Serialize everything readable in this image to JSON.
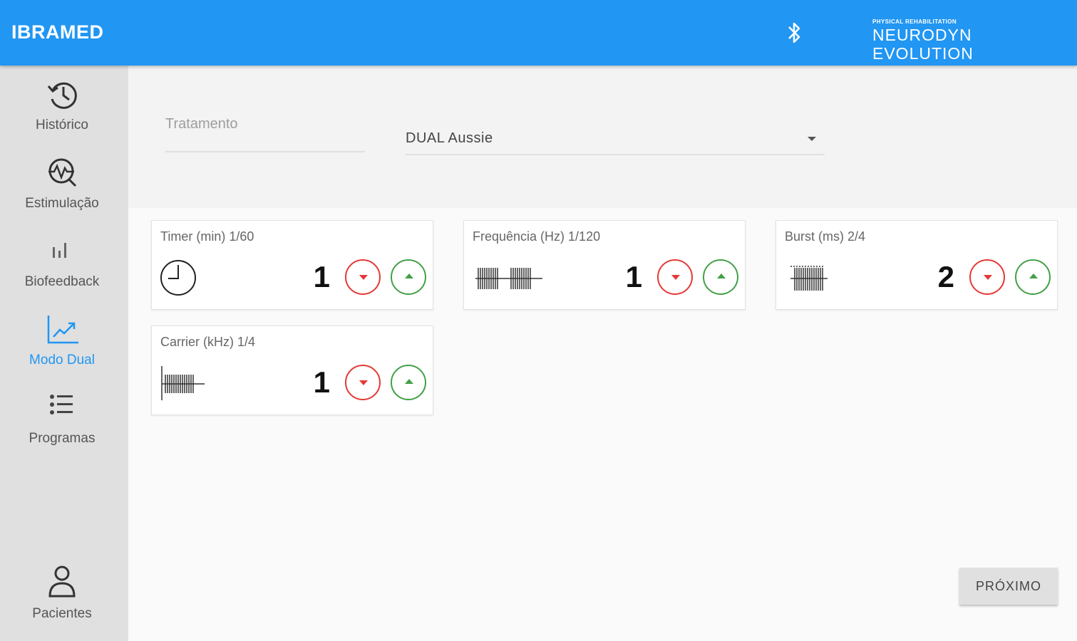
{
  "app": {
    "brand": "IBRAMED",
    "logo_small": "PHYSICAL REHABILITATION",
    "logo_big": "NEURODYN EVOLUTION",
    "accent_color": "#2196f3"
  },
  "sidebar": {
    "items": [
      {
        "label": "Histórico",
        "icon": "history-icon"
      },
      {
        "label": "Estimulação",
        "icon": "stimulation-icon"
      },
      {
        "label": "Biofeedback",
        "icon": "bar-chart-icon"
      },
      {
        "label": "Modo Dual",
        "icon": "trending-up-icon",
        "active": true
      },
      {
        "label": "Programas",
        "icon": "list-icon"
      },
      {
        "label": "Pacientes",
        "icon": "person-icon"
      }
    ]
  },
  "treatment": {
    "label": "Tratamento",
    "selected": "DUAL Aussie"
  },
  "params": [
    {
      "title": "Timer (min) 1/60",
      "value": "1",
      "icon": "clock-icon"
    },
    {
      "title": "Frequência (Hz) 1/120",
      "value": "1",
      "icon": "frequency-wave-icon"
    },
    {
      "title": "Burst (ms) 2/4",
      "value": "2",
      "icon": "burst-wave-icon"
    },
    {
      "title": "Carrier (kHz) 1/4",
      "value": "1",
      "icon": "carrier-wave-icon"
    }
  ],
  "actions": {
    "next_label": "PRÓXIMO"
  }
}
